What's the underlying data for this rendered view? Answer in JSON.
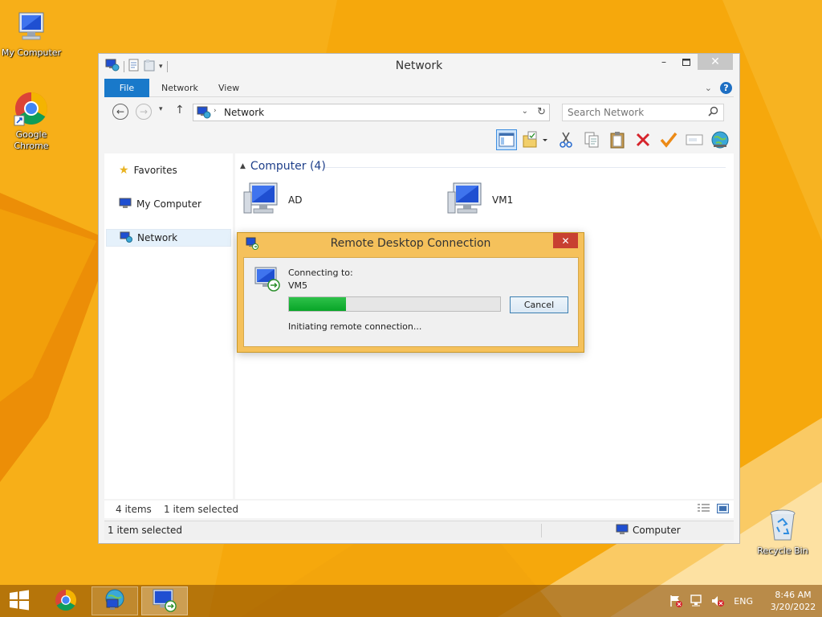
{
  "desktop": {
    "icons": [
      {
        "label": "My Computer",
        "icon": "computer-icon"
      },
      {
        "label": "Google Chrome",
        "icon": "chrome-icon"
      },
      {
        "label": "Recycle Bin",
        "icon": "recycle-bin-icon"
      }
    ],
    "wallpaper_colors": {
      "primary": "#f6a80c",
      "light": "#fbc23a",
      "dark": "#e88c06"
    }
  },
  "explorer": {
    "title": "Network",
    "ribbon_tabs": {
      "file": "File",
      "network": "Network",
      "view": "View"
    },
    "address": {
      "location": "Network"
    },
    "search": {
      "placeholder": "Search Network"
    },
    "toolbar_icons": [
      "pane-layout-icon",
      "folder-options-icon",
      "cut-icon",
      "copy-icon",
      "paste-icon",
      "delete-icon",
      "checkmark-icon",
      "rename-icon",
      "network-globe-icon"
    ],
    "nav": {
      "favorites": "Favorites",
      "my_computer": "My Computer",
      "network": "Network"
    },
    "group": {
      "header": "Computer (4)"
    },
    "items": [
      {
        "name": "AD"
      },
      {
        "name": "VM1"
      }
    ],
    "status": {
      "item_count": "4 items",
      "selection": "1 item selected",
      "lower_left": "1 item selected",
      "lower_right": "Computer"
    }
  },
  "rdc_dialog": {
    "title": "Remote Desktop Connection",
    "connecting_label": "Connecting to:",
    "target": "VM5",
    "progress": 0.27,
    "cancel_label": "Cancel",
    "status_text": "Initiating remote connection..."
  },
  "taskbar": {
    "items": [
      "start-button",
      "chrome",
      "network-explorer",
      "remote-desktop"
    ],
    "language": "ENG",
    "time": "8:46 AM",
    "date": "3/20/2022"
  },
  "colors": {
    "accent_blue": "#1979ca",
    "dialog_frame": "#f5c15b",
    "progress_green": "#1bb33b",
    "close_red": "#c84031"
  }
}
